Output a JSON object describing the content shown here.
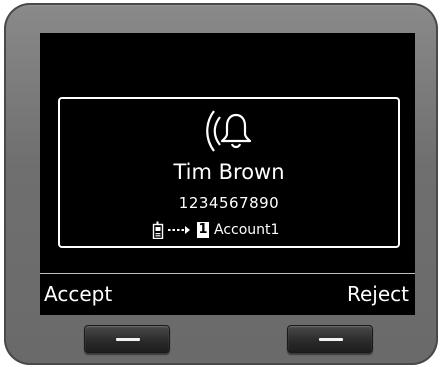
{
  "call": {
    "caller_name": "Tim Brown",
    "caller_number": "1234567890",
    "account_number": "1",
    "account_name": "Account1",
    "ring_icon": "ringing-bell-icon",
    "handset_icon": "handset-icon",
    "arrow_icon": "dotted-arrow-icon"
  },
  "softkeys": {
    "left_label": "Accept",
    "right_label": "Reject"
  },
  "colors": {
    "screen_bg": "#000000",
    "text": "#ffffff",
    "bezel": "#777777",
    "button": "#2b2b2b"
  }
}
